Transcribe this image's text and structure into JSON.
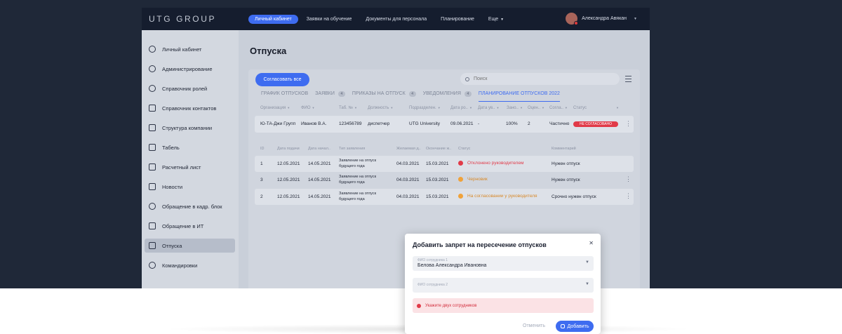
{
  "colors": {
    "accent": "#3e6cf0",
    "topbar": "#151d2e",
    "page_bg": "#1f2838",
    "danger": "#e13a48",
    "warning": "#f0a23a"
  },
  "topbar": {
    "logo": "UTG GROUP",
    "nav": [
      {
        "label": "Личный кабинет",
        "active": true
      },
      {
        "label": "Заявки на обучение"
      },
      {
        "label": "Документы для персонала"
      },
      {
        "label": "Планирование"
      },
      {
        "label": "Еще"
      }
    ],
    "user_name": "Александра Авякан"
  },
  "sidebar": {
    "items": [
      {
        "label": "Личный кабинет",
        "icon": "user-icon"
      },
      {
        "label": "Администрирование",
        "icon": "users-icon"
      },
      {
        "label": "Справочник ролей",
        "icon": "role-icon"
      },
      {
        "label": "Справочник контактов",
        "icon": "contacts-icon"
      },
      {
        "label": "Структура компании",
        "icon": "structure-icon"
      },
      {
        "label": "Табель",
        "icon": "document-icon"
      },
      {
        "label": "Расчетный лист",
        "icon": "payslip-icon"
      },
      {
        "label": "Новости",
        "icon": "news-icon"
      },
      {
        "label": "Обращение в кадр. блок",
        "icon": "hr-icon"
      },
      {
        "label": "Обращение в ИТ",
        "icon": "it-icon"
      },
      {
        "label": "Отпуска",
        "icon": "vacation-icon",
        "active": true
      },
      {
        "label": "Командировки",
        "icon": "plane-icon"
      }
    ]
  },
  "main": {
    "title": "Отпуска",
    "approve_all": "Согласовать все",
    "search_placeholder": "Поиск",
    "tabs": [
      {
        "label": "ГРАФИК ОТПУСКОВ"
      },
      {
        "label": "ЗАЯВКИ",
        "badge": "4"
      },
      {
        "label": "ПРИКАЗЫ НА ОТПУСК",
        "badge": "4"
      },
      {
        "label": "УВЕДОМЛЕНИЯ",
        "badge": "4"
      },
      {
        "label": "ПЛАНИРОВАНИЕ ОТПУСКОВ 2022",
        "active": true
      }
    ],
    "table_headers": [
      "Организация",
      "ФИО",
      "Таб. №",
      "Должность",
      "Подразделен.",
      "Дата ро..",
      "Дата ув..",
      "Зано..",
      "Оцен..",
      "Согла..",
      "Статус"
    ],
    "table_row": {
      "org": "Ю-ТА-Джи Групп",
      "fio": "Иванов В.А.",
      "tab_no": "123456789",
      "position": "диспетчер",
      "dept": "UTG University",
      "birth": "09.06.2021",
      "fired": "-",
      "percent": "100%",
      "rating": "2",
      "agree": "Частично",
      "status": "НЕ СОГЛАСОВАНО"
    },
    "detail_headers": [
      "ID",
      "Дата подачи",
      "Дата начал..",
      "Тип заявления",
      "Желаемая д..",
      "Окончание ж..",
      "Статус",
      "Комментарий"
    ],
    "detail_rows": [
      {
        "id": "1",
        "submitted": "12.05.2021",
        "start": "14.05.2021",
        "type_line1": "Заявление на отпуск",
        "type_line2": "будущего года",
        "desired": "04.03.2021",
        "end": "15.03.2021",
        "status": "Отклонено руководителем",
        "status_color": "#e13a48",
        "comment": "Нужен отпуск"
      },
      {
        "id": "3",
        "submitted": "12.05.2021",
        "start": "14.05.2021",
        "type_line1": "Заявление на отпуск",
        "type_line2": "будущего года",
        "desired": "04.03.2021",
        "end": "15.03.2021",
        "status": "Черновик",
        "status_color": "#f0a23a",
        "comment": "Нужен отпуск"
      },
      {
        "id": "2",
        "submitted": "12.05.2021",
        "start": "14.05.2021",
        "type_line1": "Заявление на отпуск",
        "type_line2": "будущего года",
        "desired": "04.03.2021",
        "end": "15.03.2021",
        "status": "На согласовании у руководителя",
        "status_color": "#f0a23a",
        "comment": "Срочно нужен отпуск"
      }
    ]
  },
  "modal": {
    "title": "Добавить запрет на пересечение отпусков",
    "field1_label": "ФИО сотрудника 1",
    "field1_value": "Белова Александра Ивановна",
    "field2_label": "ФИО сотрудника 2",
    "alert": "Укажите двух сотрудников",
    "cancel": "Отменить",
    "add": "Добавить"
  }
}
